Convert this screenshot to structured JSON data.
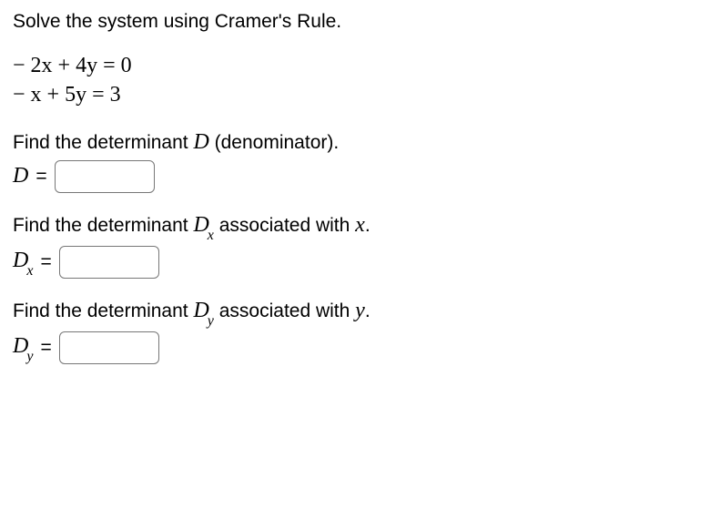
{
  "title": "Solve the system using Cramer's Rule.",
  "equations": {
    "line1": "− 2x + 4y = 0",
    "line2": "− x + 5y = 3"
  },
  "parts": {
    "d": {
      "prompt_pre": "Find the determinant ",
      "var": "D",
      "sub": "",
      "prompt_post": " (denominator).",
      "label_var": "D",
      "label_sub": "",
      "equals": "=",
      "value": ""
    },
    "dx": {
      "prompt_pre": "Find the determinant ",
      "var": "D",
      "sub": "x",
      "prompt_post": " associated with ",
      "assoc_var": "x",
      "period": ".",
      "label_var": "D",
      "label_sub": "x",
      "equals": "=",
      "value": ""
    },
    "dy": {
      "prompt_pre": "Find the determinant ",
      "var": "D",
      "sub": "y",
      "prompt_post": " associated with ",
      "assoc_var": "y",
      "period": ".",
      "label_var": "D",
      "label_sub": "y",
      "equals": "=",
      "value": ""
    }
  }
}
